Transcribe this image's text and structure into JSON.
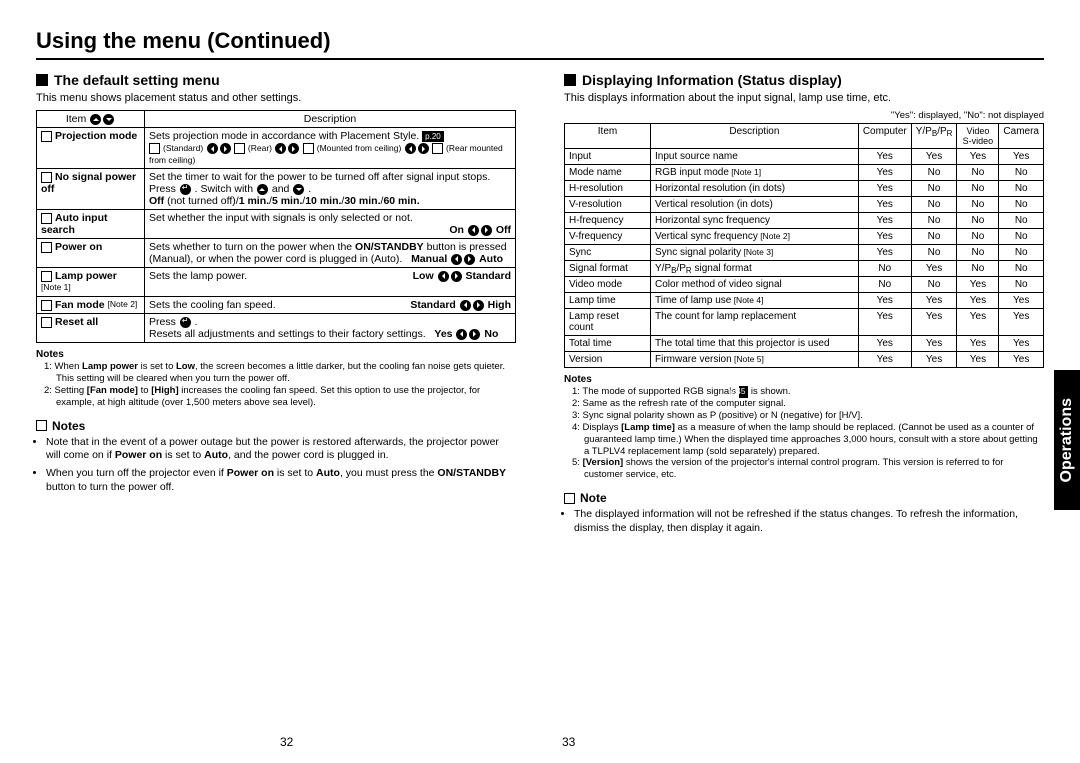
{
  "pageTitle": "Using the menu (Continued)",
  "pageLeft": "32",
  "pageRight": "33",
  "tabLabel": "Operations",
  "left": {
    "heading": "The default setting menu",
    "intro": "This menu shows placement status and other settings.",
    "headerItem": "Item",
    "headerDesc": "Description",
    "rows": {
      "projMode": {
        "label": "Projection mode",
        "desc": "Sets projection mode in accordance with Placement Style.",
        "ref": "p.20",
        "opts": "(Standard)            (Rear)            (Mounted from ceiling)            (Rear mounted from ceiling)"
      },
      "noSignal": {
        "label": "No signal power off",
        "desc1": "Set the timer to wait for the power to be turned off after signal input stops.",
        "desc2": "Press      . Switch with      and      .",
        "desc3": "Off (not turned off)/1 min./5 min./10 min./30 min./60 min."
      },
      "autoInput": {
        "label": "Auto input search",
        "desc": "Set whether the input with signals is only selected or not.",
        "opt": "On          Off"
      },
      "powerOn": {
        "label": "Power on",
        "desc": "Sets whether to turn on the power when the ON/STANDBY button is pressed (Manual), or when the power cord is plugged in (Auto).",
        "opt": "Manual          Auto"
      },
      "lampPower": {
        "label": "Lamp power",
        "note": "[Note 1]",
        "desc": "Sets the lamp power.",
        "opt": "Low          Standard"
      },
      "fanMode": {
        "label": "Fan mode",
        "note": "[Note 2]",
        "desc": "Sets the cooling fan speed.",
        "opt": "Standard          High"
      },
      "resetAll": {
        "label": "Reset all",
        "desc1": "Press      .",
        "desc2": "Resets all adjustments and settings to their factory settings.",
        "opt": "Yes          No"
      }
    },
    "notesH": "Notes",
    "notes1": "1: When Lamp power is set to Low, the screen becomes a little darker, but the cooling fan noise gets quieter. This setting will be cleared when you turn the power off.",
    "notes2": "2: Setting [Fan mode] to [High] increases the cooling fan speed. Set this option to use the projector, for example, at high altitude (over 1,500 meters above sea level).",
    "bulletsH": "Notes",
    "b1": "Note that in the event of a power outage but the power is restored afterwards, the projector power will come on if Power on is set to Auto, and the power cord is plugged in.",
    "b2": "When you turn off the projector even if Power on is set to Auto, you must press the ON/STANDBY button to turn the power off."
  },
  "right": {
    "heading": "Displaying Information (Status display)",
    "intro": "This displays information about the input signal, lamp use time, etc.",
    "legend": "\"Yes\": displayed, \"No\": not displayed",
    "hdr": {
      "item": "Item",
      "desc": "Description",
      "c1": "Computer",
      "c2": "Y/PB/PR",
      "c3": "Video S-video",
      "c4": "Camera"
    },
    "rows": [
      {
        "a": "Input",
        "b": "Input source name",
        "c": [
          "Yes",
          "Yes",
          "Yes",
          "Yes"
        ]
      },
      {
        "a": "Mode name",
        "b": "RGB input mode",
        "n": "[Note 1]",
        "c": [
          "Yes",
          "No",
          "No",
          "No"
        ]
      },
      {
        "a": "H-resolution",
        "b": "Horizontal resolution (in dots)",
        "c": [
          "Yes",
          "No",
          "No",
          "No"
        ]
      },
      {
        "a": "V-resolution",
        "b": "Vertical resolution (in dots)",
        "c": [
          "Yes",
          "No",
          "No",
          "No"
        ]
      },
      {
        "a": "H-frequency",
        "b": "Horizontal sync frequency",
        "c": [
          "Yes",
          "No",
          "No",
          "No"
        ]
      },
      {
        "a": "V-frequency",
        "b": "Vertical sync frequency",
        "n": "[Note 2]",
        "c": [
          "Yes",
          "No",
          "No",
          "No"
        ]
      },
      {
        "a": "Sync",
        "b": "Sync signal polarity",
        "n": "[Note 3]",
        "c": [
          "Yes",
          "No",
          "No",
          "No"
        ]
      },
      {
        "a": "Signal format",
        "b": "Y/PB/PR signal format",
        "c": [
          "No",
          "Yes",
          "No",
          "No"
        ]
      },
      {
        "a": "Video mode",
        "b": "Color method of video signal",
        "c": [
          "No",
          "No",
          "Yes",
          "No"
        ]
      },
      {
        "a": "Lamp time",
        "b": "Time of lamp use",
        "n": "[Note 4]",
        "c": [
          "Yes",
          "Yes",
          "Yes",
          "Yes"
        ]
      },
      {
        "a": "Lamp reset count",
        "b": "The count for lamp replacement",
        "c": [
          "Yes",
          "Yes",
          "Yes",
          "Yes"
        ]
      },
      {
        "a": "Total time",
        "b": "The total time that this projector is used",
        "c": [
          "Yes",
          "Yes",
          "Yes",
          "Yes"
        ]
      },
      {
        "a": "Version",
        "b": "Firmware version",
        "n": "[Note 5]",
        "c": [
          "Yes",
          "Yes",
          "Yes",
          "Yes"
        ]
      }
    ],
    "notesH": "Notes",
    "n1": "1: The mode of supported RGB signals ",
    "n1ref": "p.45",
    "n1b": " is shown.",
    "n2": "2: Same as the refresh rate of the computer signal.",
    "n3": "3: Sync signal polarity shown as P (positive) or N (negative) for [H/V].",
    "n4": "4: Displays [Lamp time] as a measure of when the lamp should be replaced. (Cannot be used as a counter of guaranteed lamp time.) When the displayed time approaches 3,000 hours, consult with a store about getting a TLPLV4 replacement lamp (sold separately) prepared.",
    "n5": "5: [Version] shows the version of the projector's internal control program. This version is referred to for customer service, etc.",
    "noteH": "Note",
    "note": "The displayed information will not be refreshed if the status changes. To refresh the information, dismiss the display, then display it again."
  }
}
